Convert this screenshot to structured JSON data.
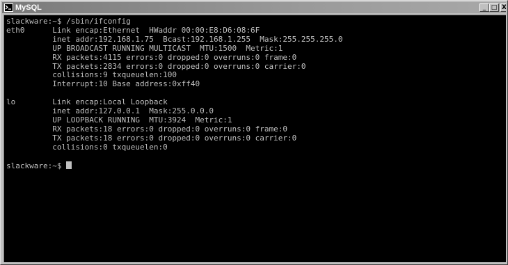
{
  "window": {
    "title": "MySQL",
    "icon": "terminal-app-icon",
    "minimize_glyph": "_",
    "maximize_glyph": "□",
    "close_glyph": "X"
  },
  "terminal": {
    "background": "#000000",
    "foreground": "#c0c0c0",
    "lines": [
      "slackware:~$ /sbin/ifconfig",
      "eth0      Link encap:Ethernet  HWaddr 00:00:E8:D6:08:6F",
      "          inet addr:192.168.1.75  Bcast:192.168.1.255  Mask:255.255.255.0",
      "          UP BROADCAST RUNNING MULTICAST  MTU:1500  Metric:1",
      "          RX packets:4115 errors:0 dropped:0 overruns:0 frame:0",
      "          TX packets:2834 errors:0 dropped:0 overruns:0 carrier:0",
      "          collisions:9 txqueuelen:100",
      "          Interrupt:10 Base address:0xff40",
      "",
      "lo        Link encap:Local Loopback",
      "          inet addr:127.0.0.1  Mask:255.0.0.0",
      "          UP LOOPBACK RUNNING  MTU:3924  Metric:1",
      "          RX packets:18 errors:0 dropped:0 overruns:0 frame:0",
      "          TX packets:18 errors:0 dropped:0 overruns:0 carrier:0",
      "          collisions:0 txqueuelen:0",
      ""
    ],
    "prompt": "slackware:~$ "
  }
}
